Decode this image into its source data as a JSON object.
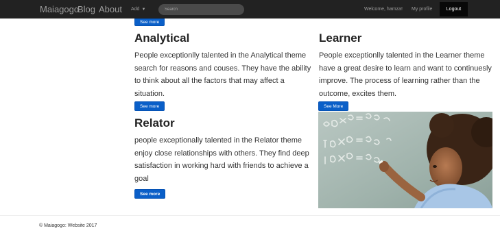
{
  "navbar": {
    "brand": "Maiagogo",
    "blog": "Blog",
    "about": "About",
    "add": "Add",
    "search_placeholder": "Search",
    "welcome": "Welcome, hamza!",
    "profile": "My profile",
    "logout": "Logout"
  },
  "top_button": "See more",
  "analytical": {
    "title": "Analytical",
    "text": "People exceptionlly talented in the Analytical theme search for reasons and couses. They have the ability to think about all the factors that may affect a situation.",
    "button": "See more"
  },
  "learner": {
    "title": "Learner",
    "text": "People exceptionlly talented in the Learner theme have a great desire to learn and want to continuesly improve. The process of learning rather than the outcome, excites them.",
    "button": "See More"
  },
  "relator": {
    "title": "Relator",
    "text": "people exceptionally talented in the Relator theme enjoy close relationships with others. They find deep satisfaction in working hard with friends to achieve a goal",
    "button": "See more"
  },
  "footer": {
    "text": "© Maiagogo: Website 2017"
  },
  "colors": {
    "navbar": "#222222",
    "button": "#0a5fc8"
  }
}
